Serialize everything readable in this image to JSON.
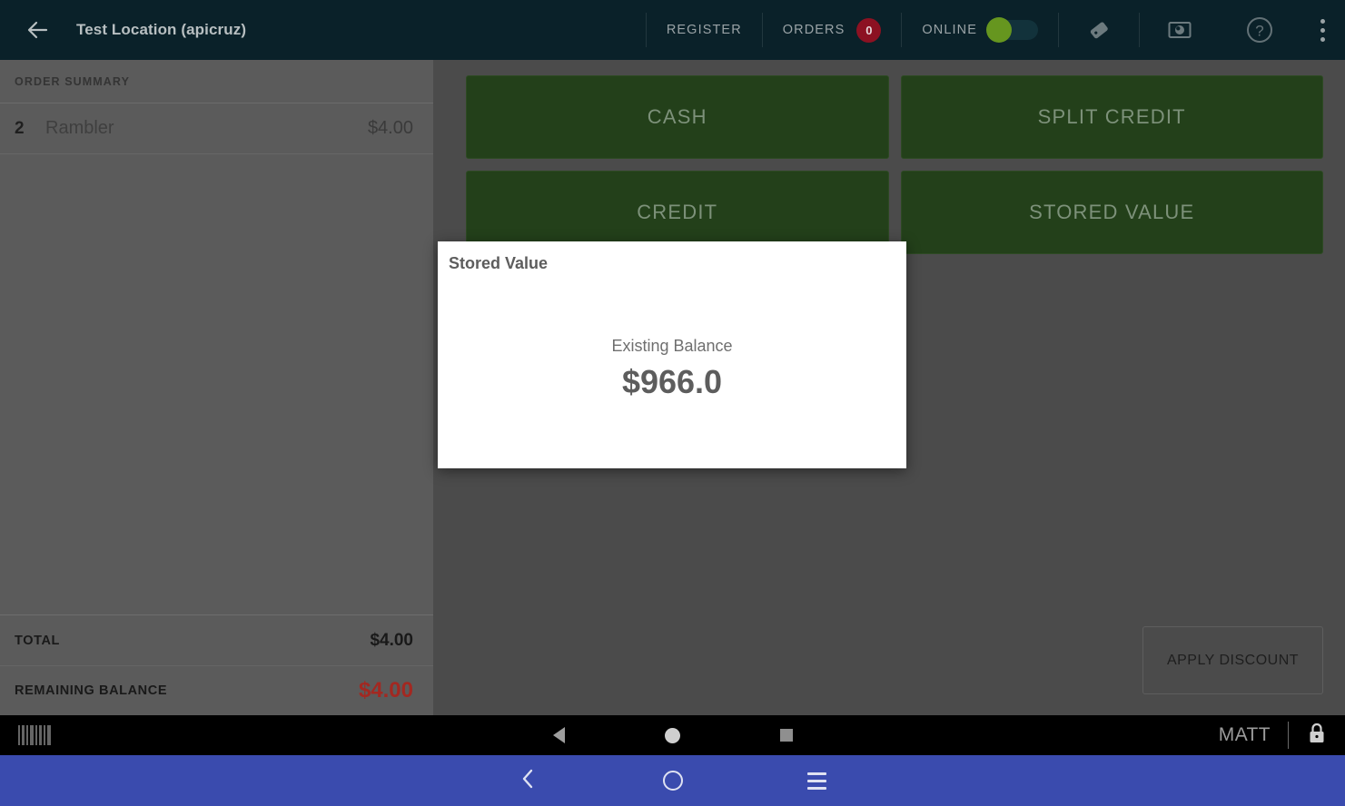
{
  "topbar": {
    "back_icon": "arrow-left-icon",
    "title": "Test Location (apicruz)",
    "register_label": "REGISTER",
    "orders_label": "ORDERS",
    "orders_count": "0",
    "online_label": "ONLINE",
    "online_state": "on",
    "tag_icon": "tag-icon",
    "camera_icon": "camera-icon",
    "help_icon": "help-circle-icon",
    "overflow_icon": "more-vertical-icon",
    "background_color": "#0a2129",
    "badge_color": "#8c1122",
    "toggle_on_color": "#66961f"
  },
  "sidebar": {
    "header": "ORDER SUMMARY",
    "items": [
      {
        "qty": "2",
        "name": "Rambler",
        "price": "$4.00"
      }
    ],
    "totals": [
      {
        "label": "TOTAL",
        "value": "$4.00",
        "emphasis": "normal"
      },
      {
        "label": "REMAINING BALANCE",
        "value": "$4.00",
        "emphasis": "warning"
      }
    ],
    "warning_color": "#a32821",
    "background_color": "#5b5b5b"
  },
  "main": {
    "payment_buttons": [
      {
        "label": "CASH"
      },
      {
        "label": "SPLIT CREDIT"
      },
      {
        "label": "CREDIT"
      },
      {
        "label": "STORED VALUE"
      }
    ],
    "apply_discount_label": "APPLY DISCOUNT",
    "button_color": "#23401a",
    "background_color": "#4b4b4b"
  },
  "dialog": {
    "title": "Stored Value",
    "balance_label": "Existing Balance",
    "balance_value": "$966.0",
    "background_color": "#ffffff"
  },
  "statusbar": {
    "barcode_icon": "barcode-icon",
    "back_icon": "system-back-icon",
    "home_icon": "system-home-icon",
    "recents_icon": "system-recents-icon",
    "user_name": "MATT",
    "lock_icon": "lock-icon",
    "background_color": "#000000"
  },
  "navbar": {
    "back_icon": "chevron-left-icon",
    "home_icon": "circle-icon",
    "menu_icon": "hamburger-icon",
    "background_color": "#3a4bae"
  }
}
